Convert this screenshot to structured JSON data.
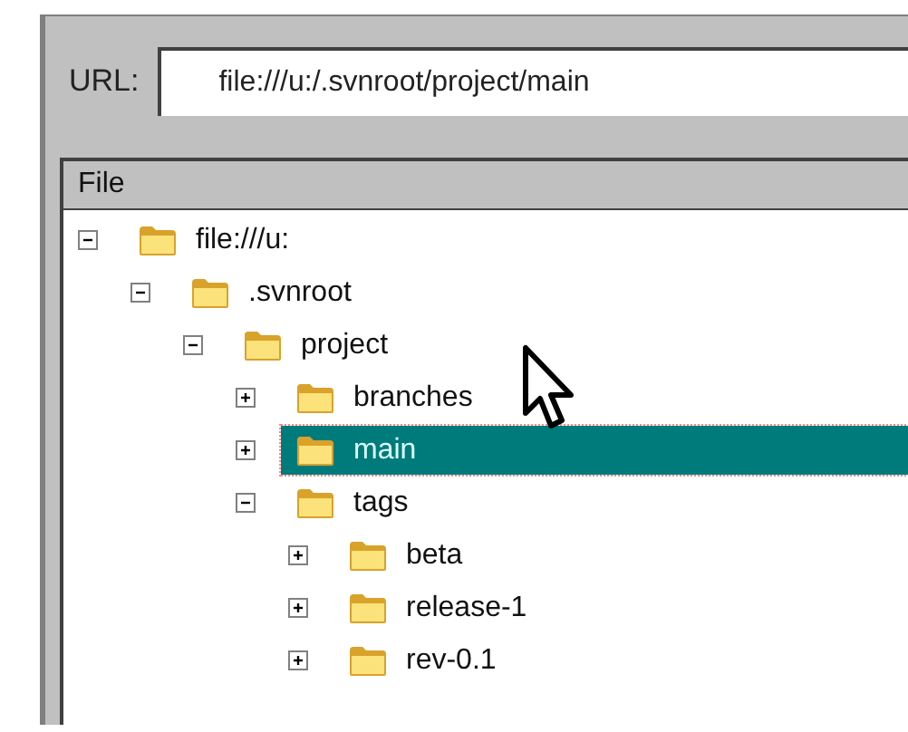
{
  "url_bar": {
    "label": "URL:",
    "value": "file:///u:/.svnroot/project/main"
  },
  "tree": {
    "column": "File",
    "items": [
      {
        "label": "file:///u:",
        "expanded": true,
        "selected": false,
        "children": [
          {
            "label": ".svnroot",
            "expanded": true,
            "selected": false,
            "children": [
              {
                "label": "project",
                "expanded": true,
                "selected": false,
                "children": [
                  {
                    "label": "branches",
                    "expanded": false,
                    "selected": false
                  },
                  {
                    "label": "main",
                    "expanded": false,
                    "selected": true
                  },
                  {
                    "label": "tags",
                    "expanded": true,
                    "selected": false,
                    "children": [
                      {
                        "label": "beta",
                        "expanded": false,
                        "selected": false
                      },
                      {
                        "label": "release-1",
                        "expanded": false,
                        "selected": false
                      },
                      {
                        "label": "rev-0.1",
                        "expanded": false,
                        "selected": false
                      }
                    ]
                  }
                ]
              }
            ]
          }
        ]
      }
    ]
  }
}
